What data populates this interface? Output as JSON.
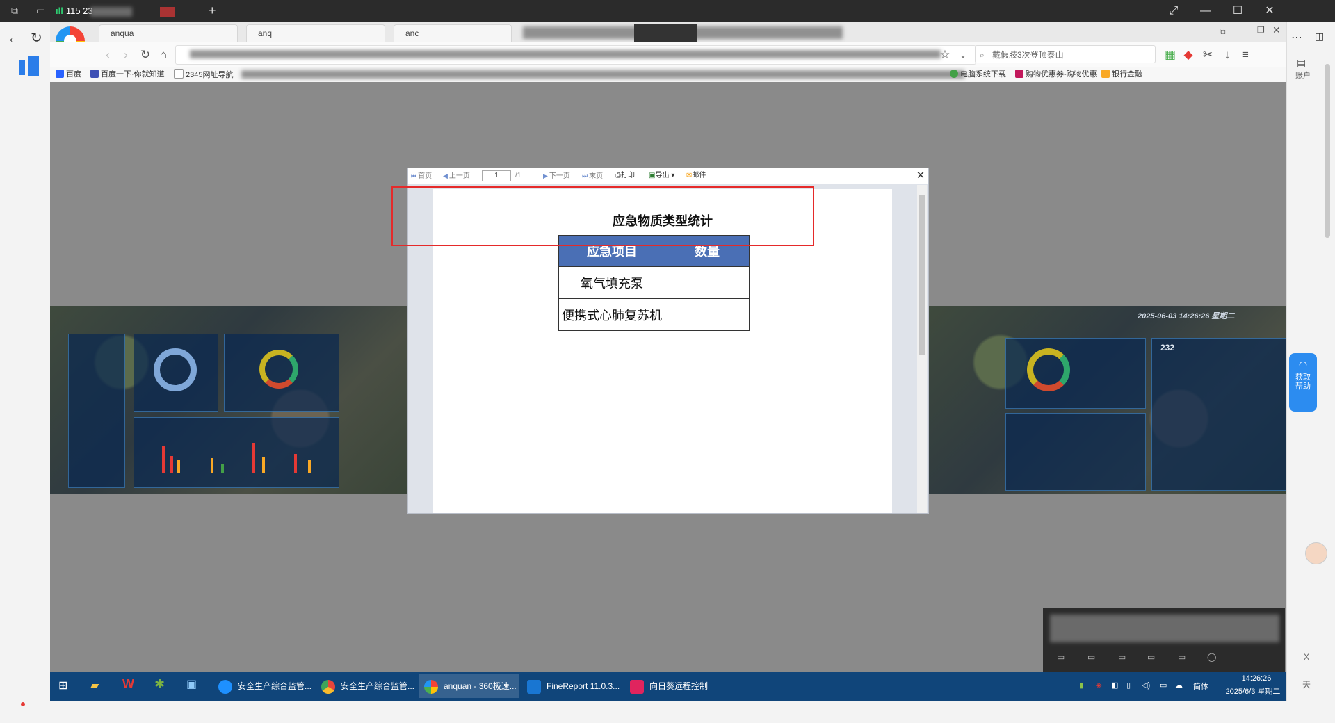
{
  "outer": {
    "signal": "115 23",
    "win_min": "—",
    "win_max": "☐",
    "win_close": "✕"
  },
  "browser": {
    "tabs": [
      "anqua",
      "anq",
      "anc"
    ],
    "search_placeholder": "戴假肢3次登顶泰山",
    "bookmarks": [
      "百度",
      "百度一下·你就知道",
      "2345网址导航",
      "电脑系统下载",
      "购物优惠券-购物优惠",
      "银行金融"
    ],
    "side_account": "账户"
  },
  "report": {
    "toolbar": {
      "first": "首页",
      "prev": "上一页",
      "page": "1",
      "total": "/1",
      "next": "下一页",
      "last": "末页",
      "print": "打印",
      "export": "导出",
      "mail": "邮件"
    },
    "title": "应急物质类型统计",
    "columns": [
      "应急项目",
      "数量"
    ],
    "rows": [
      {
        "item": "氧气填充泵",
        "qty": ""
      },
      {
        "item": "便携式心肺复苏机",
        "qty": ""
      }
    ],
    "header_color": "#4a6fb5"
  },
  "dashboard": {
    "datetime": "2025-06-03  14:26:26  星期二",
    "count": "232"
  },
  "help": {
    "label": "获取帮助"
  },
  "taskbar": {
    "items": [
      {
        "label": "安全生产综合监管...",
        "color": "#1e90ff"
      },
      {
        "label": "安全生产综合监管...",
        "color": "#e8453c"
      },
      {
        "label": "anquan - 360极速...",
        "color": "#ffb300"
      },
      {
        "label": "FineReport 11.0.3...",
        "color": "#1976d2"
      },
      {
        "label": "向日葵远程控制",
        "color": "#e0245e"
      }
    ],
    "ime": "简体",
    "time": "14:26:26",
    "date": "2025/6/3 星期二"
  },
  "colors": {
    "highlight_box": "#e52a2a",
    "taskbar": "#10457a"
  }
}
